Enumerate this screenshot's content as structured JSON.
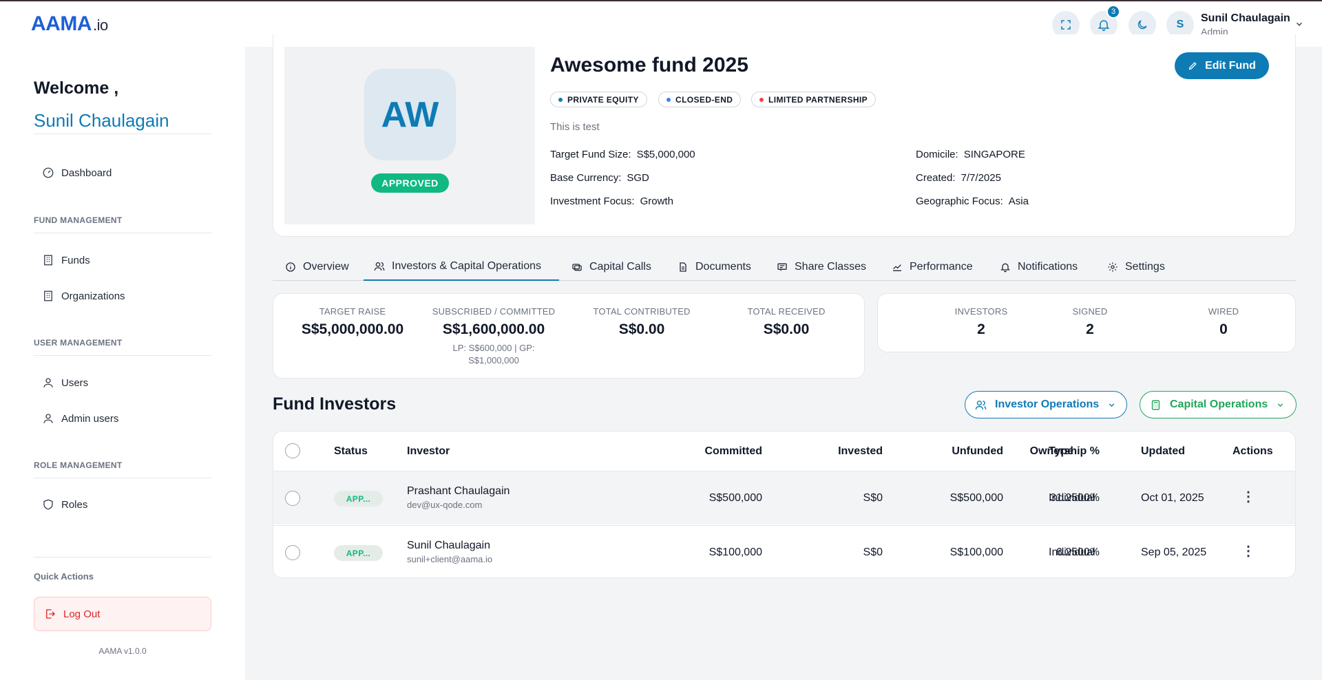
{
  "app": {
    "logo_main": "AAMA",
    "logo_suffix": ".io"
  },
  "topbar": {
    "notification_count": "3",
    "user_initial": "S",
    "user_name": "Sunil Chaulagain",
    "user_role": "Admin"
  },
  "sidebar": {
    "welcome": "Welcome ,",
    "welcome_name": "Sunil Chaulagain",
    "dashboard": "Dashboard",
    "section_fund": "FUND MANAGEMENT",
    "funds": "Funds",
    "organizations": "Organizations",
    "section_user": "USER MANAGEMENT",
    "users": "Users",
    "admin_users": "Admin users",
    "section_role": "ROLE MANAGEMENT",
    "roles": "Roles",
    "quick_actions": "Quick Actions",
    "logout": "Log Out",
    "version": "AAMA v1.0.0"
  },
  "fund": {
    "initials": "AW",
    "status": "APPROVED",
    "title": "Awesome fund 2025",
    "edit_label": "Edit Fund",
    "tags": [
      {
        "label": "PRIVATE EQUITY",
        "color": "#0e7bb5"
      },
      {
        "label": "CLOSED-END",
        "color": "#3b82f6"
      },
      {
        "label": "LIMITED PARTNERSHIP",
        "color": "#ef4444"
      }
    ],
    "description": "This is test",
    "details": {
      "target_size_label": "Target Fund Size:",
      "target_size": "S$5,000,000",
      "base_currency_label": "Base Currency:",
      "base_currency": "SGD",
      "investment_focus_label": "Investment Focus:",
      "investment_focus": "Growth",
      "domicile_label": "Domicile:",
      "domicile": "SINGAPORE",
      "created_label": "Created:",
      "created": "7/7/2025",
      "geographic_focus_label": "Geographic Focus:",
      "geographic_focus": "Asia"
    }
  },
  "tabs": {
    "overview": "Overview",
    "investors": "Investors & Capital Operations",
    "capital_calls": "Capital Calls",
    "documents": "Documents",
    "share_classes": "Share Classes",
    "performance": "Performance",
    "notifications": "Notifications",
    "settings": "Settings"
  },
  "stats": {
    "target_raise_label": "TARGET RAISE",
    "target_raise": "S$5,000,000.00",
    "subscribed_label": "SUBSCRIBED / COMMITTED",
    "subscribed": "S$1,600,000.00",
    "subscribed_sub1": "LP: S$600,000 | GP:",
    "subscribed_sub2": "S$1,000,000",
    "contributed_label": "TOTAL CONTRIBUTED",
    "contributed": "S$0.00",
    "received_label": "TOTAL RECEIVED",
    "received": "S$0.00",
    "investors_label": "INVESTORS",
    "investors": "2",
    "signed_label": "SIGNED",
    "signed": "2",
    "wired_label": "WIRED",
    "wired": "0"
  },
  "investors_section": {
    "title": "Fund Investors",
    "investor_ops": "Investor Operations",
    "capital_ops": "Capital Operations"
  },
  "table": {
    "headers": {
      "status": "Status",
      "investor": "Investor",
      "committed": "Committed",
      "invested": "Invested",
      "unfunded": "Unfunded",
      "ownership": "Ownership %",
      "type": "Type",
      "updated": "Updated",
      "actions": "Actions"
    },
    "rows": [
      {
        "status": "APP...",
        "name": "Prashant Chaulagain",
        "email": "dev@ux-qode.com",
        "committed": "S$500,000",
        "invested": "S$0",
        "unfunded": "S$500,000",
        "ownership": "31.2500%",
        "type": "Individual",
        "updated": "Oct 01, 2025"
      },
      {
        "status": "APP...",
        "name": "Sunil Chaulagain",
        "email": "sunil+client@aama.io",
        "committed": "S$100,000",
        "invested": "S$0",
        "unfunded": "S$100,000",
        "ownership": "6.2500%",
        "type": "Individual",
        "updated": "Sep 05, 2025"
      }
    ]
  }
}
